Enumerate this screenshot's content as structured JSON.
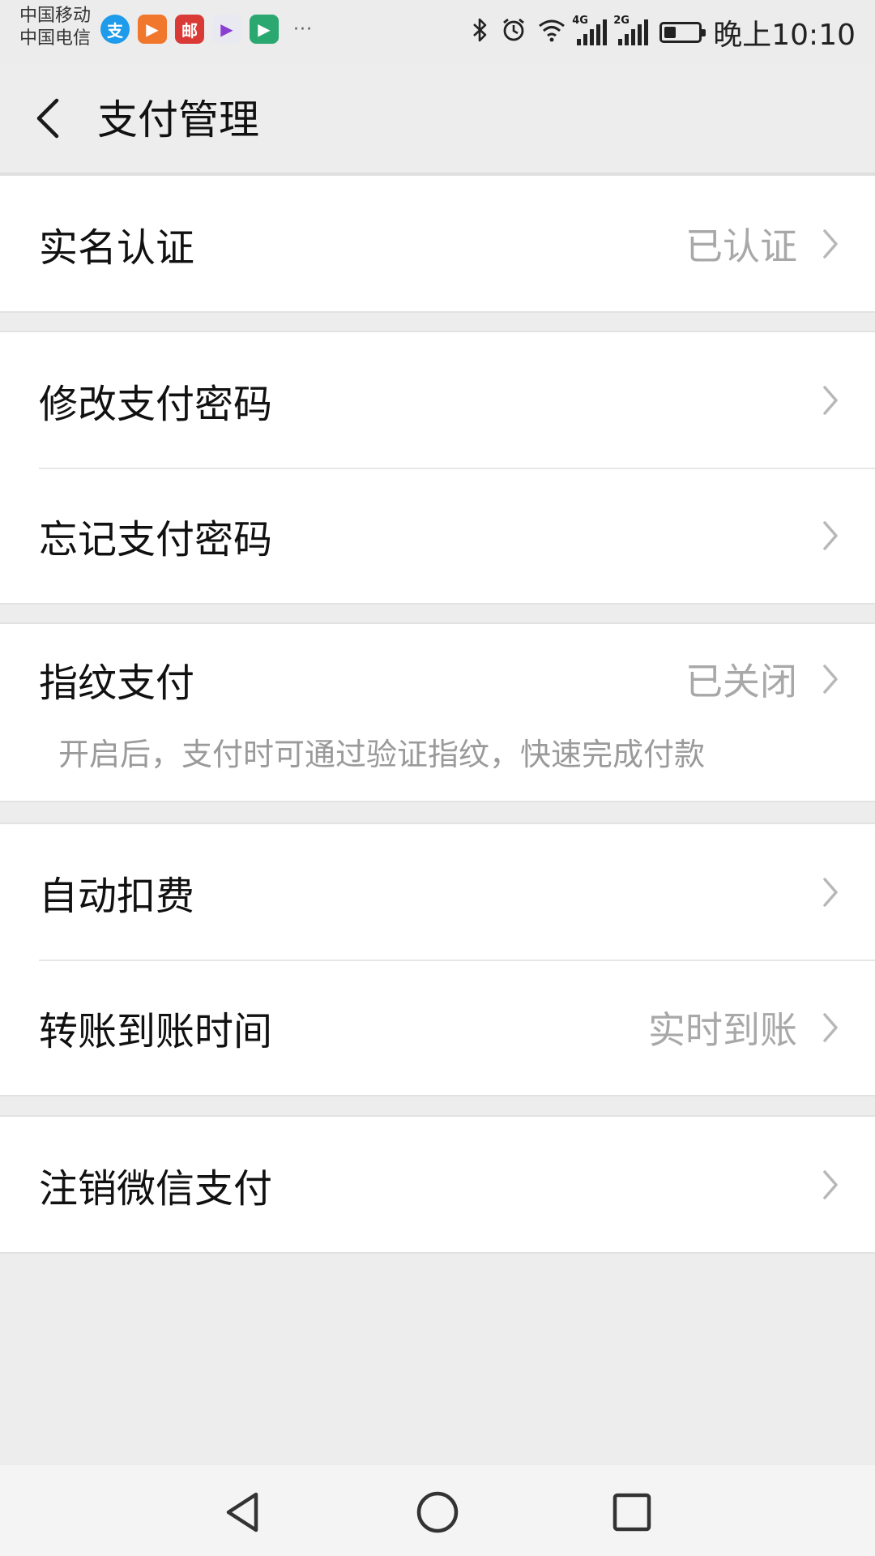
{
  "status_bar": {
    "carrier_1": "中国移动",
    "carrier_2": "中国电信",
    "app_icons": [
      {
        "icon": "alipay-icon",
        "glyph": "支",
        "color": "#1e9bea"
      },
      {
        "icon": "video-app-icon",
        "glyph": "▶",
        "color": "#f0772c"
      },
      {
        "icon": "postal-app-icon",
        "glyph": "邮",
        "color": "#d93a36"
      },
      {
        "icon": "play-store-icon",
        "glyph": "▶",
        "color": "#e9e9f2"
      },
      {
        "icon": "media-app-icon",
        "glyph": "▶",
        "color": "#2aa870"
      }
    ],
    "more": "···",
    "network_1": "4G",
    "network_2": "2G",
    "battery_level": 0.35,
    "time": "晚上10:10"
  },
  "header": {
    "title": "支付管理",
    "back_icon": "chevron-left-icon"
  },
  "groups": [
    {
      "rows": [
        {
          "label": "实名认证",
          "value": "已认证"
        }
      ]
    },
    {
      "rows": [
        {
          "label": "修改支付密码",
          "value": ""
        },
        {
          "label": "忘记支付密码",
          "value": ""
        }
      ]
    },
    {
      "rows": [
        {
          "label": "指纹支付",
          "value": "已关闭",
          "description": "开启后，支付时可通过验证指纹，快速完成付款"
        }
      ]
    },
    {
      "rows": [
        {
          "label": "自动扣费",
          "value": ""
        },
        {
          "label": "转账到账时间",
          "value": "实时到账"
        }
      ]
    },
    {
      "rows": [
        {
          "label": "注销微信支付",
          "value": ""
        }
      ]
    }
  ],
  "nav_bar": {
    "back": "triangle-back-icon",
    "home": "circle-home-icon",
    "recents": "square-recents-icon"
  },
  "colors": {
    "background": "#ededed",
    "card": "#ffffff",
    "value_text": "#a8a8a8"
  }
}
